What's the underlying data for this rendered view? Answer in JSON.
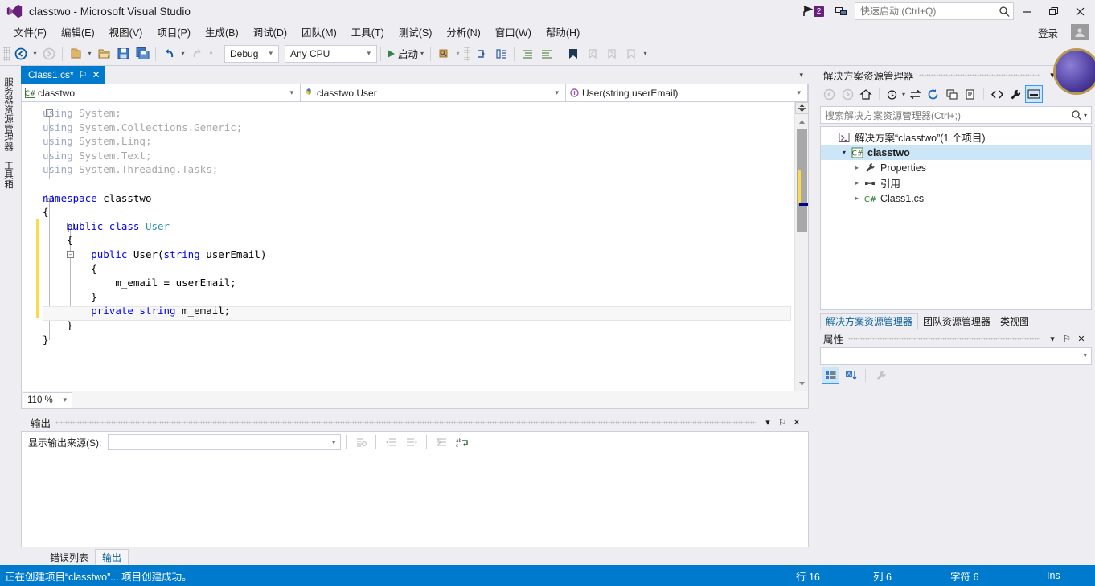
{
  "window": {
    "title": "classtwo - Microsoft Visual Studio",
    "minimize": "—",
    "maximize": "❐",
    "close": "✕"
  },
  "titlebar": {
    "notification_badge": "2",
    "quick_launch_placeholder": "快速启动 (Ctrl+Q)",
    "quick_launch_value": ""
  },
  "menu": {
    "items": [
      {
        "label": "文件(F)"
      },
      {
        "label": "编辑(E)"
      },
      {
        "label": "视图(V)"
      },
      {
        "label": "项目(P)"
      },
      {
        "label": "生成(B)"
      },
      {
        "label": "调试(D)"
      },
      {
        "label": "团队(M)"
      },
      {
        "label": "工具(T)"
      },
      {
        "label": "测试(S)"
      },
      {
        "label": "分析(N)"
      },
      {
        "label": "窗口(W)"
      },
      {
        "label": "帮助(H)"
      }
    ],
    "signin_label": "登录"
  },
  "toolbar": {
    "configuration": "Debug",
    "platform": "Any CPU",
    "start_label": "启动",
    "caret": "▾"
  },
  "left_rail": {
    "tabs": [
      {
        "label": "服务器资源管理器"
      },
      {
        "label": "工具箱"
      }
    ]
  },
  "editor": {
    "tab_title": "Class1.cs*",
    "tab_close": "✕",
    "tab_pin": "⚐",
    "nav": {
      "type_scope": "classtwo",
      "class_scope": "classtwo.User",
      "member_scope": "User(string userEmail)"
    },
    "zoom_level": "110 %",
    "code_lines": [
      {
        "indent": 0,
        "tokens": [
          {
            "t": "using ",
            "c": "graykw"
          },
          {
            "t": "System;",
            "c": "gray"
          }
        ]
      },
      {
        "indent": 0,
        "tokens": [
          {
            "t": "using ",
            "c": "graykw"
          },
          {
            "t": "System.Collections.Generic;",
            "c": "gray"
          }
        ]
      },
      {
        "indent": 0,
        "tokens": [
          {
            "t": "using ",
            "c": "graykw"
          },
          {
            "t": "System.Linq;",
            "c": "gray"
          }
        ]
      },
      {
        "indent": 0,
        "tokens": [
          {
            "t": "using ",
            "c": "graykw"
          },
          {
            "t": "System.Text;",
            "c": "gray"
          }
        ]
      },
      {
        "indent": 0,
        "tokens": [
          {
            "t": "using ",
            "c": "graykw"
          },
          {
            "t": "System.Threading.Tasks;",
            "c": "gray"
          }
        ]
      },
      {
        "indent": 0,
        "tokens": []
      },
      {
        "indent": 0,
        "tokens": [
          {
            "t": "namespace ",
            "c": "kw"
          },
          {
            "t": "classtwo",
            "c": "plain"
          }
        ]
      },
      {
        "indent": 0,
        "tokens": [
          {
            "t": "{",
            "c": "plain"
          }
        ]
      },
      {
        "indent": 1,
        "tokens": [
          {
            "t": "public class ",
            "c": "kw"
          },
          {
            "t": "User",
            "c": "ty"
          }
        ]
      },
      {
        "indent": 1,
        "tokens": [
          {
            "t": "{",
            "c": "plain"
          }
        ]
      },
      {
        "indent": 2,
        "tokens": [
          {
            "t": "public ",
            "c": "kw"
          },
          {
            "t": "User(",
            "c": "plain"
          },
          {
            "t": "string",
            "c": "kw"
          },
          {
            "t": " userEmail)",
            "c": "plain"
          }
        ]
      },
      {
        "indent": 2,
        "tokens": [
          {
            "t": "{",
            "c": "plain"
          }
        ]
      },
      {
        "indent": 3,
        "tokens": [
          {
            "t": "m_email = userEmail;",
            "c": "plain"
          }
        ]
      },
      {
        "indent": 2,
        "tokens": [
          {
            "t": "}",
            "c": "plain"
          }
        ]
      },
      {
        "indent": 2,
        "tokens": [
          {
            "t": "private string ",
            "c": "kw"
          },
          {
            "t": "m_email;",
            "c": "plain"
          }
        ]
      },
      {
        "indent": 1,
        "tokens": [
          {
            "t": "}",
            "c": "plain"
          }
        ]
      },
      {
        "indent": 0,
        "tokens": [
          {
            "t": "}",
            "c": "plain"
          }
        ]
      }
    ]
  },
  "output_pane": {
    "title": "输出",
    "source_label": "显示输出来源(S):",
    "source_value": "",
    "content": "",
    "tabs": [
      {
        "label": "错误列表",
        "active": false
      },
      {
        "label": "输出",
        "active": true
      }
    ],
    "buttons": {
      "dropdown": "▾",
      "pin": "⚐",
      "close": "✕"
    }
  },
  "solution_explorer": {
    "title": "解决方案资源管理器",
    "search_placeholder": "搜索解决方案资源管理器(Ctrl+;)",
    "search_value": "",
    "tree": [
      {
        "label": "解决方案“classtwo”(1 个项目)",
        "level": 0,
        "expander": "",
        "icon": "solution-icon",
        "selected": false,
        "bold": false
      },
      {
        "label": "classtwo",
        "level": 1,
        "expander": "▾",
        "icon": "csproj-icon",
        "selected": true,
        "bold": true
      },
      {
        "label": "Properties",
        "level": 2,
        "expander": "▸",
        "icon": "wrench-icon",
        "selected": false,
        "bold": false
      },
      {
        "label": "引用",
        "level": 2,
        "expander": "▸",
        "icon": "references-icon",
        "selected": false,
        "bold": false
      },
      {
        "label": "Class1.cs",
        "level": 2,
        "expander": "▸",
        "icon": "cs-file-icon",
        "selected": false,
        "bold": false
      }
    ],
    "tabs": [
      {
        "label": "解决方案资源管理器",
        "active": true
      },
      {
        "label": "团队资源管理器",
        "active": false
      },
      {
        "label": "类视图",
        "active": false
      }
    ],
    "buttons": {
      "dropdown": "▾",
      "pin": "⚐",
      "close": "✕"
    }
  },
  "properties_pane": {
    "title": "属性",
    "selected_object": "",
    "buttons": {
      "dropdown": "▾",
      "pin": "⚐",
      "close": "✕"
    }
  },
  "status_bar": {
    "message": "正在创建项目“classtwo”... 项目创建成功。",
    "line": "行 16",
    "column": "列 6",
    "character": "字符 6",
    "insert_mode": "Ins"
  },
  "colors": {
    "accent": "#007acc",
    "brand_purple": "#68217a",
    "changebar_yellow": "#fbdb4a",
    "keyword_blue": "#0000ff",
    "type_teal": "#2b91af"
  }
}
